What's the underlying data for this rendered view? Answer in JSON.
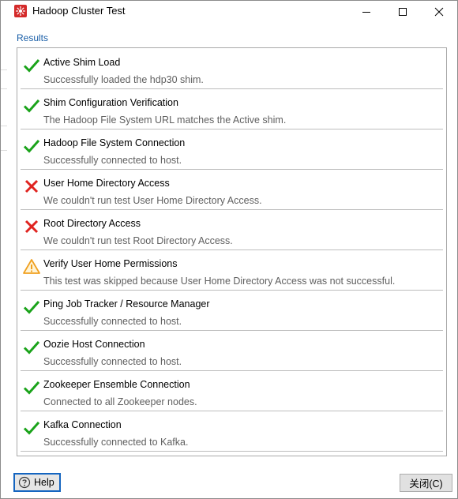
{
  "window": {
    "title": "Hadoop Cluster Test",
    "app_icon": "pentaho-icon",
    "controls": {
      "minimize": "minimize-icon",
      "maximize": "maximize-icon",
      "close": "close-icon"
    }
  },
  "results": {
    "label": "Results",
    "items": [
      {
        "status": "success",
        "icon": "checkmark-icon",
        "title": "Active Shim Load",
        "description": "Successfully loaded the hdp30 shim."
      },
      {
        "status": "success",
        "icon": "checkmark-icon",
        "title": "Shim Configuration Verification",
        "description": "The Hadoop File System URL matches the Active shim."
      },
      {
        "status": "success",
        "icon": "checkmark-icon",
        "title": "Hadoop File System Connection",
        "description": "Successfully connected to host."
      },
      {
        "status": "failure",
        "icon": "error-x-icon",
        "title": "User Home Directory Access",
        "description": "We couldn't run test User Home Directory Access."
      },
      {
        "status": "failure",
        "icon": "error-x-icon",
        "title": "Root Directory Access",
        "description": "We couldn't run test Root Directory Access."
      },
      {
        "status": "warning",
        "icon": "warning-icon",
        "title": "Verify User Home Permissions",
        "description": "This test was skipped because User Home Directory Access was not successful."
      },
      {
        "status": "success",
        "icon": "checkmark-icon",
        "title": "Ping Job Tracker / Resource Manager",
        "description": "Successfully connected to host."
      },
      {
        "status": "success",
        "icon": "checkmark-icon",
        "title": "Oozie Host Connection",
        "description": "Successfully connected to host."
      },
      {
        "status": "success",
        "icon": "checkmark-icon",
        "title": "Zookeeper Ensemble Connection",
        "description": "Connected to all Zookeeper nodes."
      },
      {
        "status": "success",
        "icon": "checkmark-icon",
        "title": "Kafka Connection",
        "description": "Successfully connected to Kafka."
      }
    ]
  },
  "footer": {
    "help_label": "Help",
    "help_icon": "help-icon",
    "close_label": "关闭(C)"
  },
  "colors": {
    "success": "#1aa31a",
    "failure": "#e0231f",
    "warning": "#f0a020",
    "results_label": "#1a5fa8",
    "focus_border": "#1565c0"
  }
}
